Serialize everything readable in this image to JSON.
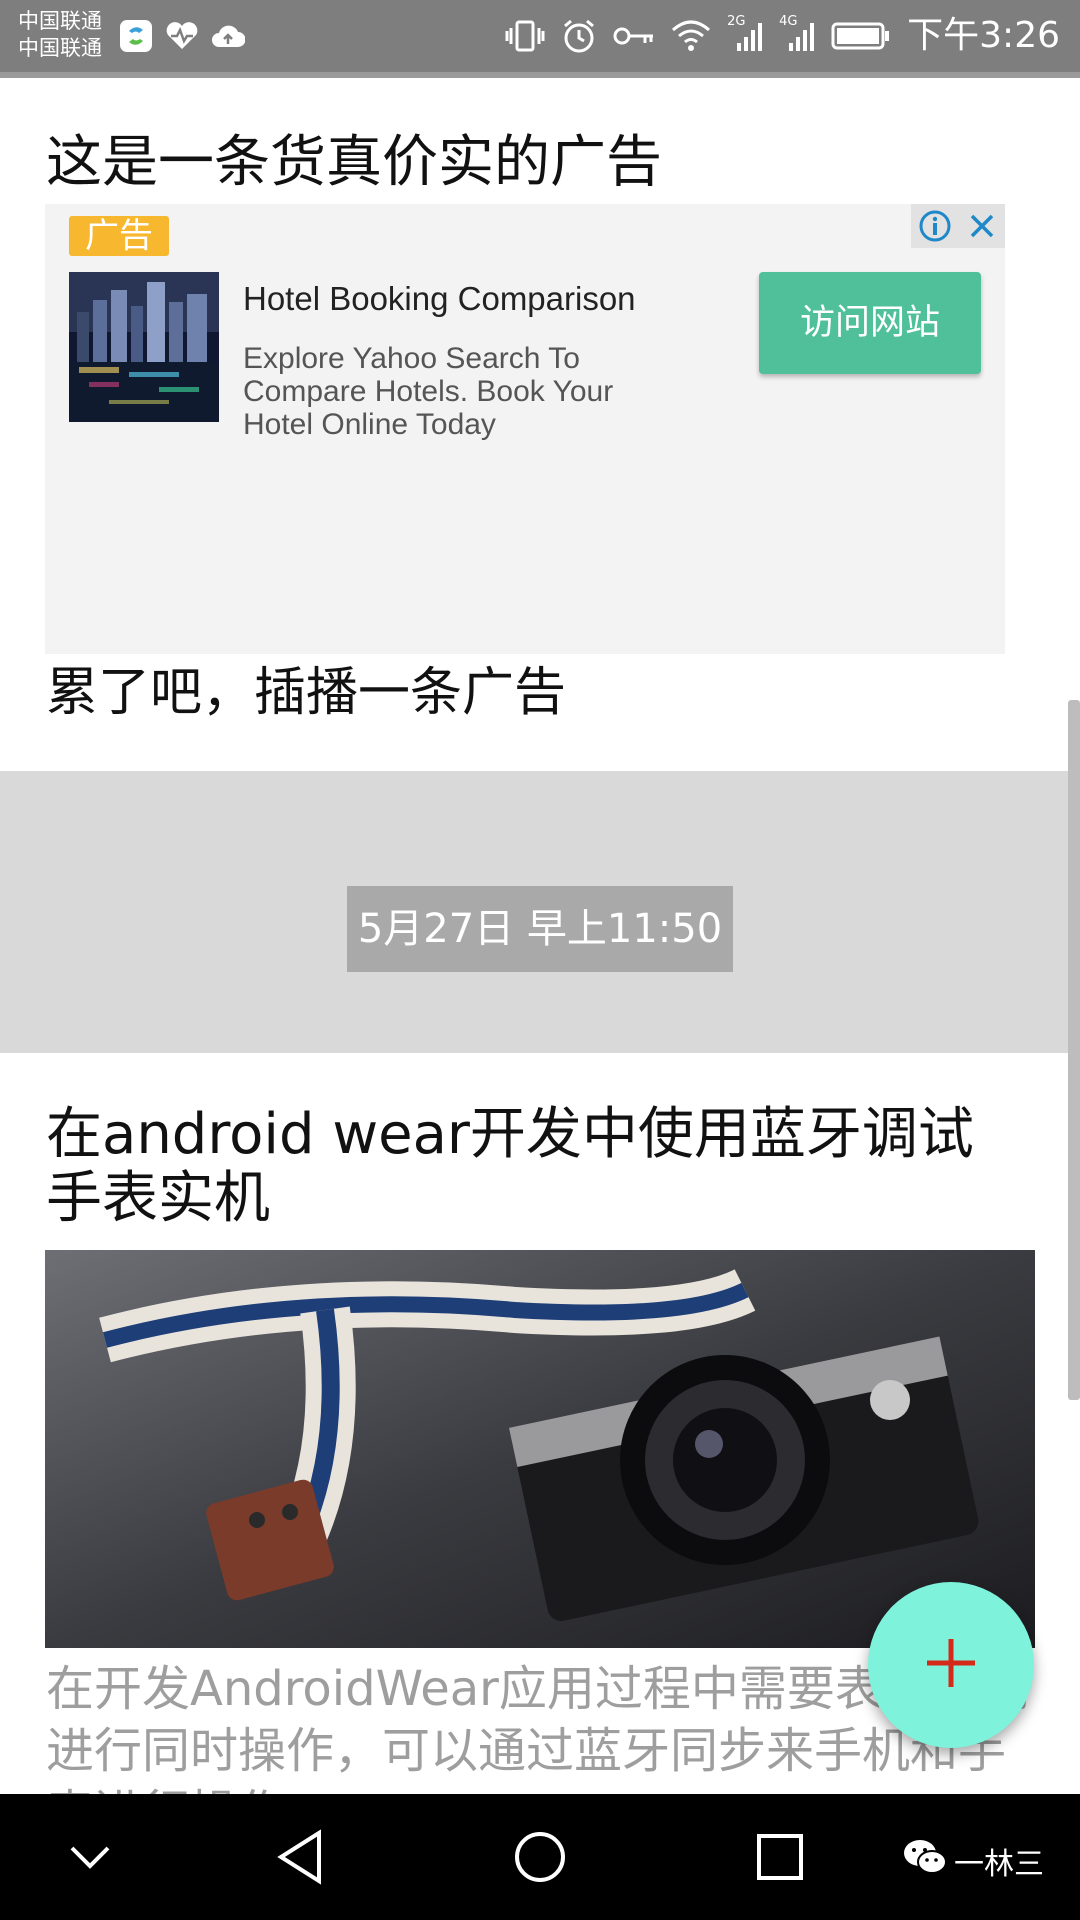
{
  "status_bar": {
    "carrier_1": "中国联通",
    "carrier_2": "中国联通",
    "network_2g": "2G",
    "network_4g": "4G",
    "time": "下午3:26"
  },
  "posts": [
    {
      "title": "这是一条货真价实的广告",
      "ad": {
        "badge": "广告",
        "headline": "Hotel Booking Comparison",
        "description": "Explore Yahoo Search To Compare Hotels. Book Your Hotel Online Today",
        "cta_label": "访问网站",
        "cta_color": "#4fc09a",
        "badge_color": "#f7b830"
      }
    },
    {
      "title": "累了吧，插播一条广告"
    }
  ],
  "date_divider": "5月27日 早上11:50",
  "article": {
    "title": "在android wear开发中使用蓝牙调试手表实机",
    "excerpt": "在开发AndroidWear应用过程中需要表和手机进行同时操作，可以通过蓝牙同步来手机和手表进行操作"
  },
  "fab": {
    "icon": "plus-icon",
    "color": "#7ff2dc"
  },
  "watermark": "一林三",
  "icons": {
    "app1": "app-s-icon",
    "app2": "heart-rate-icon",
    "app3": "cloud-upload-icon",
    "vibrate": "vibrate-icon",
    "alarm": "alarm-icon",
    "key": "key-icon",
    "wifi": "wifi-icon",
    "battery": "battery-icon"
  }
}
